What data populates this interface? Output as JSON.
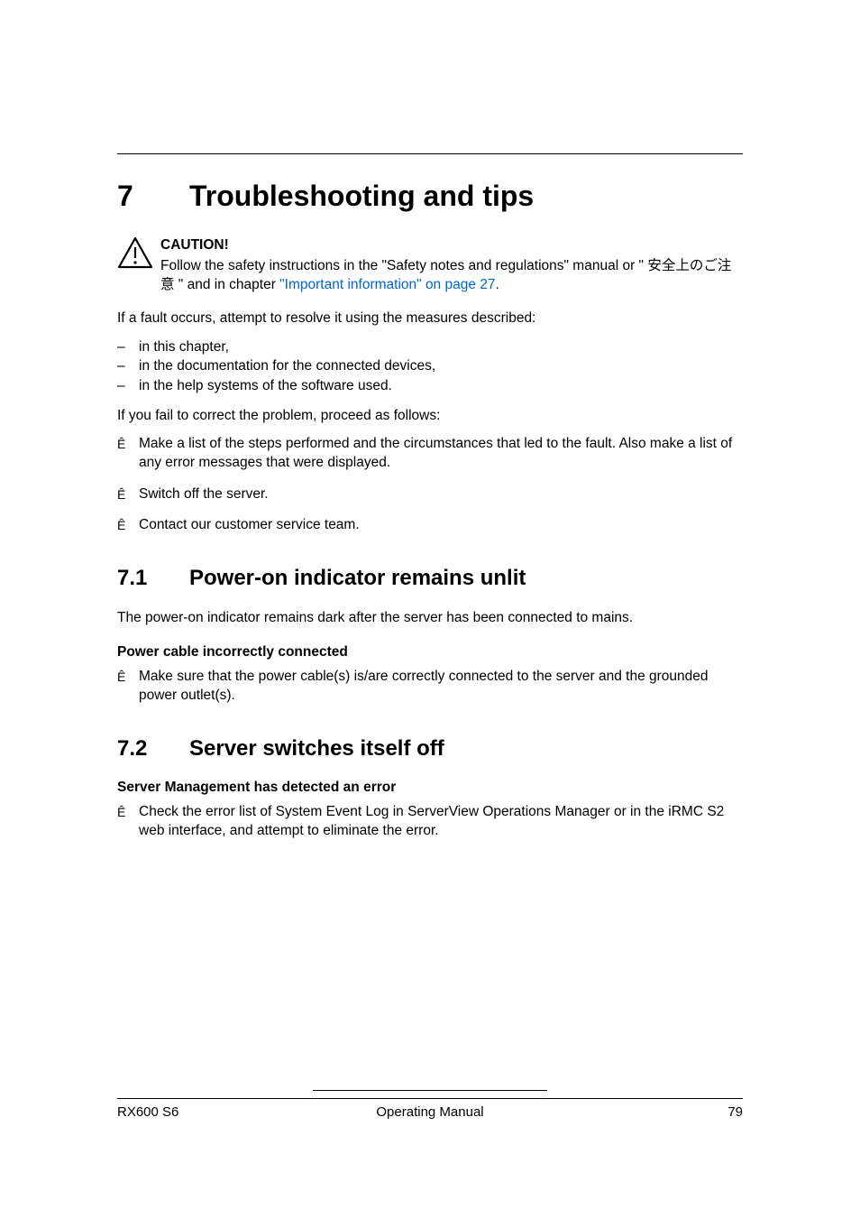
{
  "chapter": {
    "number": "7",
    "title": "Troubleshooting and tips"
  },
  "caution": {
    "title": "CAUTION!",
    "text_before": "Follow the safety instructions in the \"Safety notes and regulations\" manual or \" 安全上のご注意 \" and in chapter ",
    "link_text": "\"Important information\" on page 27",
    "text_after": "."
  },
  "intro": "If a fault occurs, attempt to resolve it using the measures described:",
  "dash_items": [
    "in this chapter,",
    "in the documentation for the connected devices,",
    "in the help systems of the software used."
  ],
  "fail_text": "If you fail to correct the problem, proceed as follows:",
  "steps": [
    "Make a list of the steps performed and the circumstances that led to the fault. Also make a list of any error messages that were displayed.",
    "Switch off the server.",
    "Contact our customer service team."
  ],
  "section71": {
    "number": "7.1",
    "title": "Power-on indicator remains unlit",
    "body": "The power-on indicator remains dark after the server has been connected to mains.",
    "subheading": "Power cable incorrectly connected",
    "step": "Make sure that the power cable(s) is/are correctly connected to the server and the grounded power outlet(s)."
  },
  "section72": {
    "number": "7.2",
    "title": "Server switches itself off",
    "subheading": "Server Management has detected an error",
    "step": "Check the error list of System Event Log in ServerView Operations Manager or in the iRMC S2 web interface, and attempt to eliminate the error."
  },
  "footer": {
    "left": "RX600 S6",
    "center": "Operating Manual",
    "right": "79"
  },
  "markers": {
    "dash": "–",
    "arrow": "Ê"
  }
}
